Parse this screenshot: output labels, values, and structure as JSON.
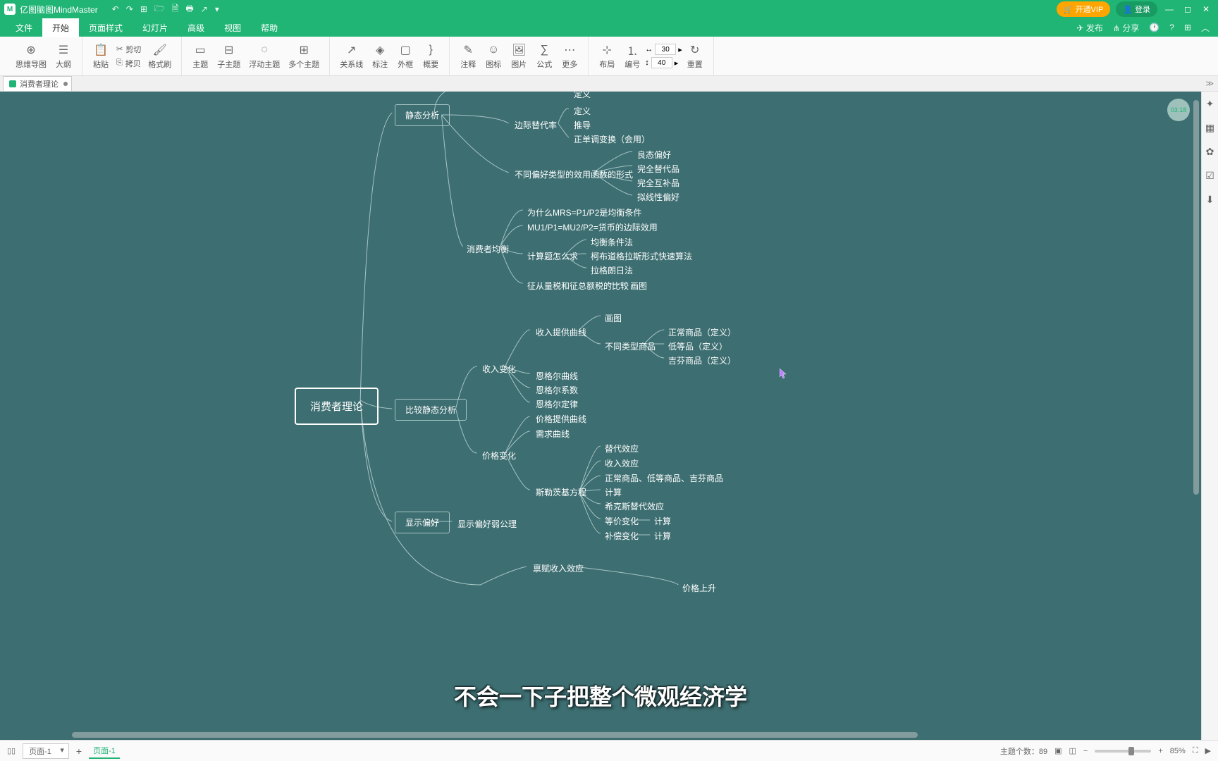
{
  "app": {
    "name": "亿图脑图MindMaster"
  },
  "titlebar": {
    "vip": "开通VIP",
    "login": "登录"
  },
  "menu": {
    "file": "文件",
    "home": "开始",
    "pagestyle": "页面样式",
    "slideshow": "幻灯片",
    "advanced": "高级",
    "view": "视图",
    "help": "帮助",
    "publish": "发布",
    "share": "分享"
  },
  "ribbon": {
    "mindmap": "思维导图",
    "outline": "大纲",
    "paste": "粘贴",
    "cut": "剪切",
    "copy": "拷贝",
    "format": "格式刷",
    "topic": "主题",
    "subtopic": "子主题",
    "floating": "浮动主题",
    "multiple": "多个主题",
    "relation": "关系线",
    "callout": "标注",
    "boundary": "外框",
    "summary": "概要",
    "note": "注释",
    "icon": "图标",
    "image": "图片",
    "formula": "公式",
    "more": "更多",
    "layout": "布局",
    "number": "编号",
    "width": "30",
    "height": "40",
    "reset": "重置"
  },
  "doctab": {
    "name": "消费者理论"
  },
  "timestamp": "03:18",
  "mindmap": {
    "root": "消费者理论",
    "static": "静态分析",
    "comparative": "比较静态分析",
    "revealed": "显示偏好",
    "revealed_weak": "显示偏好弱公理",
    "def_top": "定义",
    "mrs": "边际替代率",
    "mrs_def": "定义",
    "mrs_derive": "推导",
    "mrs_mono": "正单调变换（会用）",
    "utility_forms": "不同偏好类型的效用函数的形式",
    "uf1": "良态偏好",
    "uf2": "完全替代品",
    "uf3": "完全互补品",
    "uf4": "拟线性偏好",
    "equilibrium": "消费者均衡",
    "eq1": "为什么MRS=P1/P2是均衡条件",
    "eq2": "MU1/P1=MU2/P2=货币的边际效用",
    "eq3": "计算题怎么求",
    "eq3a": "均衡条件法",
    "eq3b": "柯布道格拉斯形式快速算法",
    "eq3c": "拉格朗日法",
    "eq4": "征从量税和征总额税的比较",
    "eq4a": "画图",
    "income_change": "收入变化",
    "ic1": "收入提供曲线",
    "ic1a": "画图",
    "ic1b": "不同类型商品",
    "ic1b1": "正常商品（定义）",
    "ic1b2": "低等品（定义）",
    "ic1b3": "吉芬商品（定义）",
    "ic2": "恩格尔曲线",
    "ic3": "恩格尔系数",
    "ic4": "恩格尔定律",
    "price_change": "价格变化",
    "pc1": "价格提供曲线",
    "pc2": "需求曲线",
    "slutsky": "斯勒茨基方程",
    "sl1": "替代效应",
    "sl2": "收入效应",
    "sl3": "正常商品、低等商品、吉芬商品",
    "sl4": "计算",
    "sl5": "希克斯替代效应",
    "sl6": "等价变化",
    "sl6a": "计算",
    "sl7": "补偿变化",
    "sl7a": "计算",
    "endowment": "禀赋收入效应",
    "price_up": "价格上升"
  },
  "subtitle": "不会一下子把整个微观经济学",
  "status": {
    "page_selector": "页面-1",
    "page_tab": "页面-1",
    "topic_count_label": "主题个数：",
    "topic_count": "89",
    "zoom": "85%"
  }
}
